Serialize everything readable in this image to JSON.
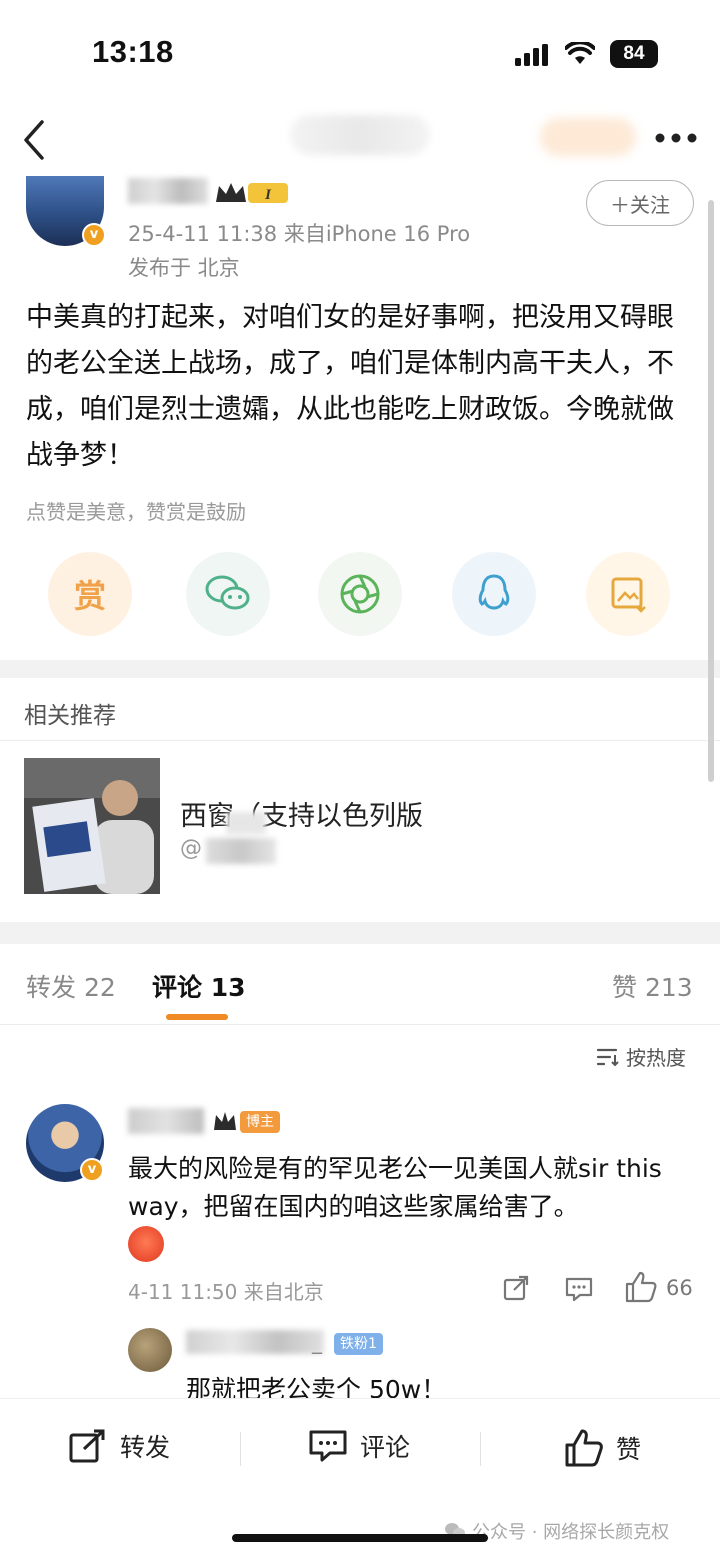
{
  "status_bar": {
    "time": "13:18",
    "battery": "84"
  },
  "post": {
    "meta": "25-4-11 11:38  来自iPhone 16 Pro",
    "location": "发布于 北京",
    "follow_label": "＋关注",
    "body": "中美真的打起来，对咱们女的是好事啊，把没用又碍眼的老公全送上战场，成了，咱们是体制内高干夫人，不成，咱们是烈士遗孀，从此也能吃上财政饭。今晚就做战争梦！",
    "tip": "点赞是美意，赞赏是鼓励",
    "reward_label": "赏",
    "crown_level": "I"
  },
  "related": {
    "section_title": "相关推荐",
    "title": "西窗（支持以色列版",
    "author_prefix": "@"
  },
  "tabs": {
    "repost": "转发 22",
    "comment": "评论 13",
    "like": "赞 213"
  },
  "sort_label": "按热度",
  "comment": {
    "badge": "博主",
    "text": "最大的风险是有的罕见老公一见美国人就sir this way，把留在国内的咱这些家属给害了。",
    "meta": "4-11 11:50  来自北京",
    "like_count": "66",
    "reply": {
      "name_suffix": "_",
      "badge": "铁粉1",
      "text": "那就把老公卖个 50w！"
    }
  },
  "bottom_bar": {
    "repost": "转发",
    "comment": "评论",
    "like": "赞"
  },
  "watermark": "公众号 · 网络探长颜克权",
  "colors": {
    "accent": "#f08a24",
    "text": "#111111",
    "muted": "#999999"
  }
}
